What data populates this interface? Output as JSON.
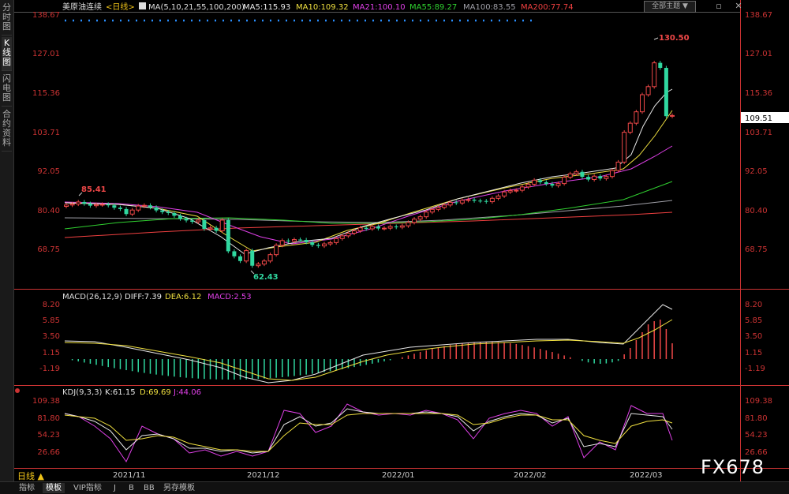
{
  "left_tabs": [
    "分时图",
    "K线图",
    "闪电图",
    "合约资料"
  ],
  "header": {
    "symbol": "美原油连续",
    "period": "<日线>",
    "ma_params": "MA(5,10,21,55,100,200)",
    "ma_items": [
      {
        "text": "MA5:115.93",
        "color": "#e8e8e8"
      },
      {
        "text": "MA10:109.32",
        "color": "#f0e040"
      },
      {
        "text": "MA21:100.10",
        "color": "#e040e8"
      },
      {
        "text": "MA55:89.27",
        "color": "#30d030"
      },
      {
        "text": "MA100:83.55",
        "color": "#a0a0a8"
      },
      {
        "text": "MA200:77.74",
        "color": "#f04040"
      }
    ],
    "theme_button": "全部主题",
    "theme_arrow": "▼",
    "toolbar_icons": [
      "restore-icon",
      "close-icon"
    ]
  },
  "price_axis": [
    "138.67",
    "127.01",
    "115.36",
    "103.71",
    "92.05",
    "80.40",
    "68.75"
  ],
  "current_price": "109.51",
  "annotations": {
    "high": "130.50",
    "low": "62.43",
    "left_high": "85.41"
  },
  "macd": {
    "title": "MACD(26,12,9)",
    "diff": "DIFF:7.39",
    "dea": "DEA:6.12",
    "macd": "MACD:2.53",
    "axis": [
      "8.20",
      "5.85",
      "3.50",
      "1.15",
      "-1.19"
    ]
  },
  "kdj": {
    "title": "KDJ(9,3,3)",
    "k": "K:61.15",
    "d": "D:69.69",
    "j": "J:44.06",
    "axis": [
      "109.38",
      "81.80",
      "54.23",
      "26.66"
    ]
  },
  "date_axis": [
    "2021/11",
    "2021/12",
    "2022/01",
    "2022/02",
    "2022/03"
  ],
  "daily_label": "日线 ▲",
  "bottom_tabs": [
    "指标",
    "模板",
    "VIP指标",
    "J",
    "B",
    "BB",
    "另存模板"
  ],
  "watermark": "FX678",
  "colors": {
    "up": "#f04848",
    "down": "#30d8a0",
    "ma5": "#e8e8e8",
    "ma10": "#f0e040",
    "ma21": "#e040e8",
    "ma55": "#30d030",
    "ma100": "#a0a0a8",
    "ma200": "#f04040"
  },
  "chart_data": {
    "type": "candlestick",
    "closes": [
      82.8,
      83.1,
      83.7,
      83.2,
      82.6,
      82.9,
      83.0,
      82.7,
      82.0,
      81.6,
      80.1,
      81.3,
      82.5,
      82.7,
      82.1,
      81.2,
      80.7,
      80.4,
      79.6,
      78.7,
      78.2,
      77.8,
      78.3,
      75.7,
      76.0,
      75.1,
      78.3,
      69.0,
      67.5,
      66.1,
      69.2,
      64.7,
      65.2,
      66.1,
      68.0,
      70.8,
      72.2,
      72.0,
      72.5,
      72.4,
      71.7,
      70.9,
      70.6,
      71.2,
      71.6,
      72.8,
      73.6,
      74.4,
      75.1,
      76.0,
      75.7,
      76.4,
      75.8,
      75.9,
      76.4,
      76.2,
      76.6,
      77.6,
      78.6,
      79.3,
      80.7,
      81.5,
      82.1,
      82.8,
      83.6,
      83.4,
      84.2,
      84.4,
      84.1,
      84.0,
      83.8,
      84.8,
      85.5,
      86.7,
      87.1,
      87.2,
      88.2,
      89.0,
      90.2,
      89.6,
      89.1,
      88.6,
      89.2,
      91.1,
      92.1,
      92.7,
      91.2,
      90.4,
      91.4,
      90.7,
      91.3,
      93.1,
      95.6,
      104.5,
      107.2,
      110.6,
      115.7,
      118.1,
      125.2,
      123.7,
      109.3,
      109.5
    ]
  }
}
